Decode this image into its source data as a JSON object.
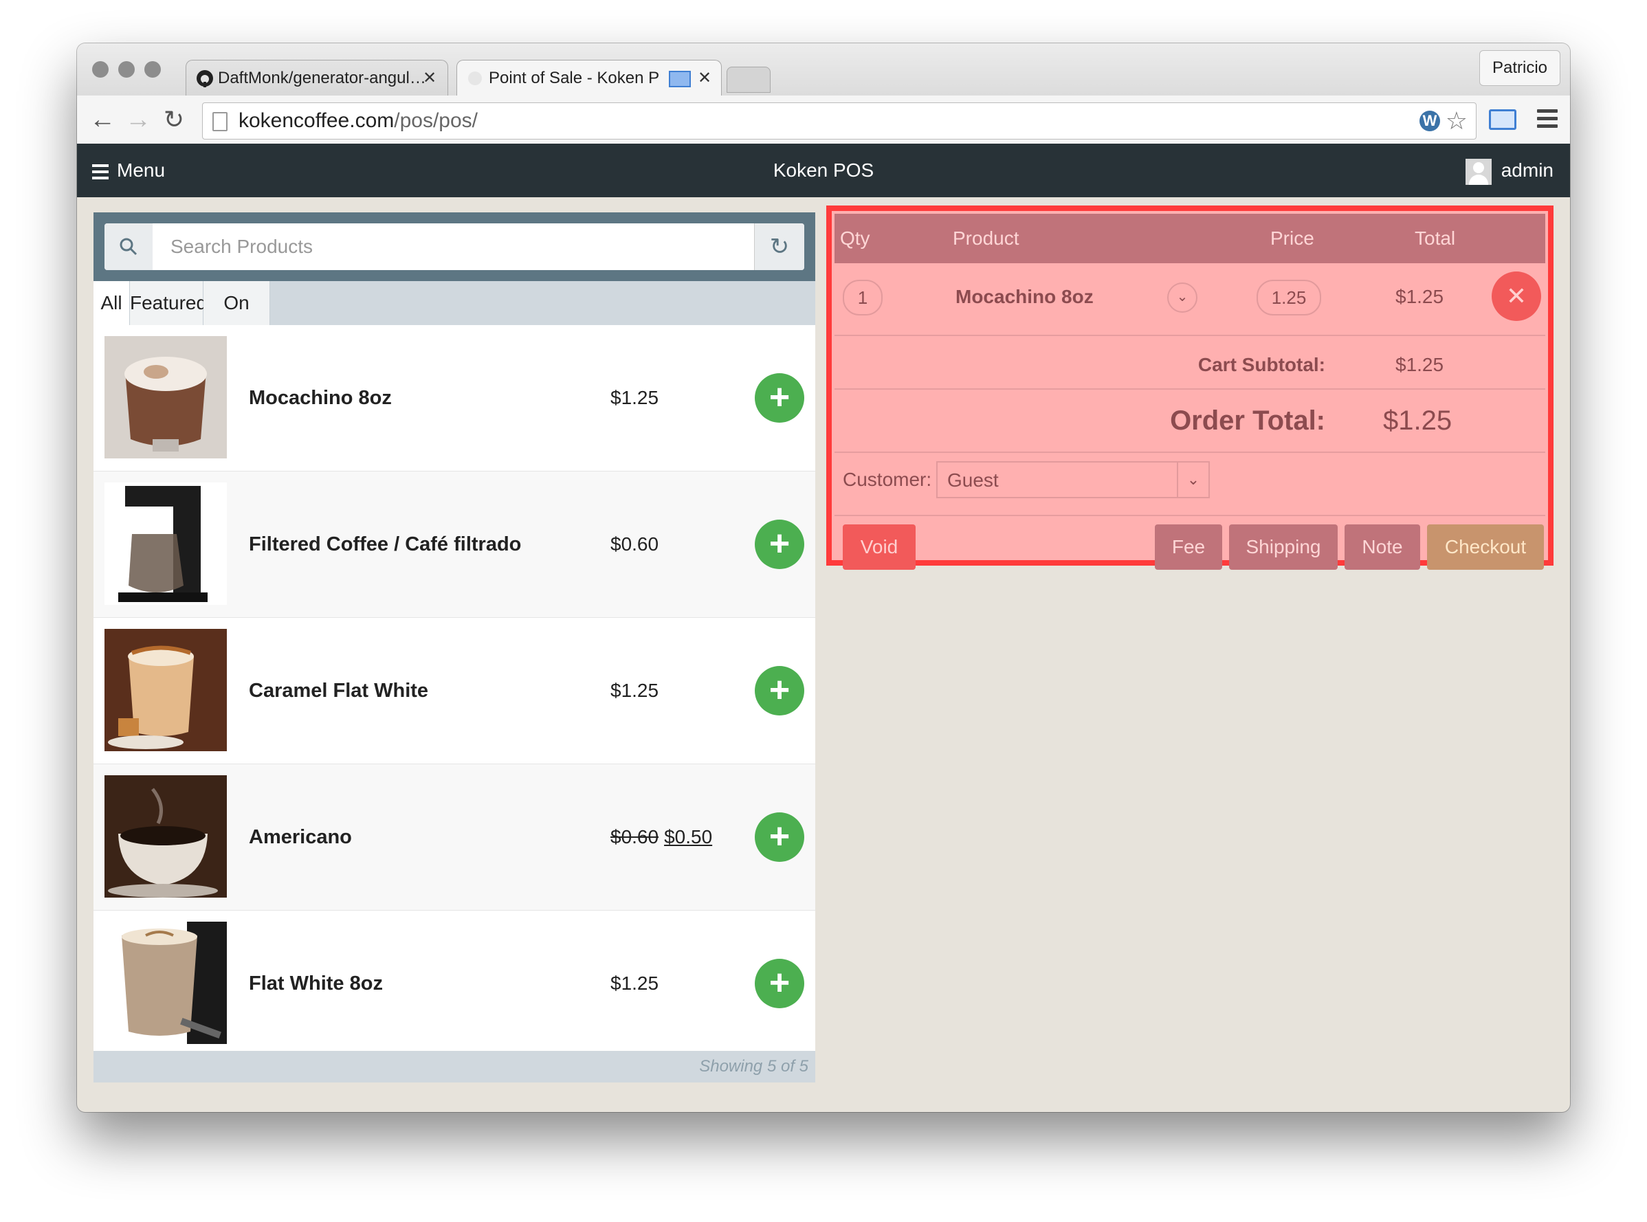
{
  "browser": {
    "tabs": [
      {
        "title": "DaftMonk/generator-angul…",
        "active": false
      },
      {
        "title": "Point of Sale - Koken P",
        "active": true
      }
    ],
    "profile": "Patricio",
    "url_host": "kokencoffee.com",
    "url_path": "/pos/pos/"
  },
  "app": {
    "menu_label": "Menu",
    "title": "Koken POS",
    "user": "admin"
  },
  "products": {
    "search_placeholder": "Search Products",
    "tabs": [
      "All",
      "Featured",
      "On Sale"
    ],
    "active_tab": "All",
    "items": [
      {
        "name": "Mocachino 8oz",
        "price": "$1.25"
      },
      {
        "name": "Filtered Coffee / Café filtrado",
        "price": "$0.60"
      },
      {
        "name": "Caramel Flat White",
        "price": "$1.25"
      },
      {
        "name": "Americano",
        "old_price": "$0.60",
        "price": "$0.50"
      },
      {
        "name": "Flat White 8oz",
        "price": "$1.25"
      }
    ],
    "showing": "Showing 5 of 5"
  },
  "cart": {
    "headers": {
      "qty": "Qty",
      "product": "Product",
      "price": "Price",
      "total": "Total"
    },
    "item": {
      "qty": "1",
      "name": "Mocachino 8oz",
      "price": "1.25",
      "total": "$1.25"
    },
    "subtotal_label": "Cart Subtotal:",
    "subtotal": "$1.25",
    "order_total_label": "Order Total:",
    "order_total": "$1.25",
    "customer_label": "Customer:",
    "customer": "Guest",
    "buttons": {
      "void": "Void",
      "fee": "Fee",
      "shipping": "Shipping",
      "note": "Note",
      "checkout": "Checkout"
    }
  },
  "colors": {
    "navbar": "#283237",
    "add_button": "#4caf50",
    "highlight_border": "#ff3b3b",
    "highlight_fill": "#ffb0b0"
  }
}
